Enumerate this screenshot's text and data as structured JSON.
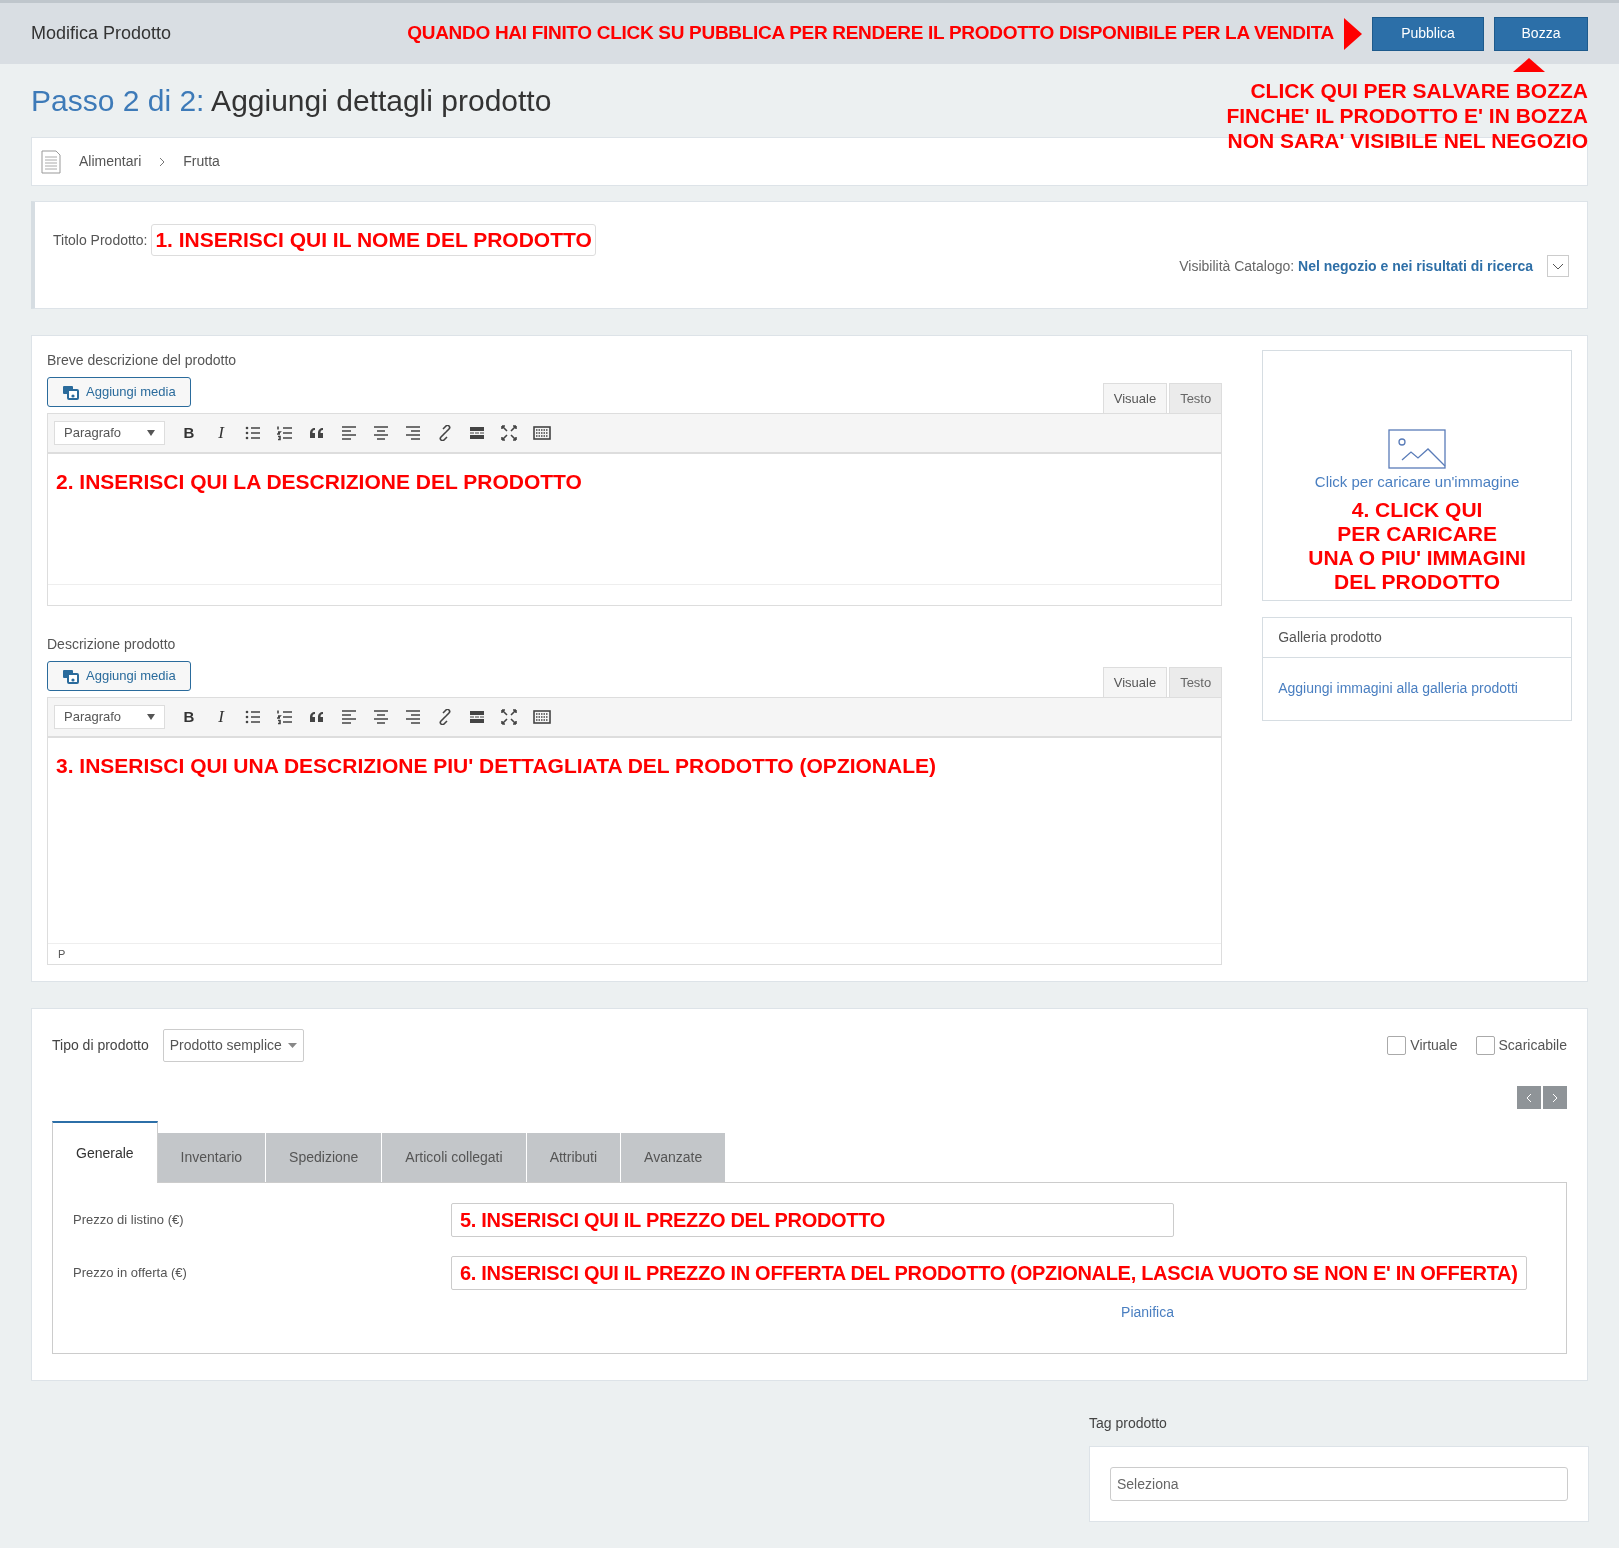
{
  "header": {
    "title": "Modifica Prodotto",
    "annotation": "QUANDO HAI FINITO CLICK SU PUBBLICA PER RENDERE IL PRODOTTO DISPONIBILE PER LA VENDITA",
    "buttons": [
      {
        "label": "Pubblica"
      },
      {
        "label": "Bozza"
      }
    ],
    "draft_annotation": [
      "CLICK QUI PER SALVARE BOZZA",
      "FINCHE' IL PRODOTTO E' IN BOZZA",
      "NON SARA' VISIBILE NEL NEGOZIO"
    ]
  },
  "page_heading": {
    "step": "Passo 2 di 2:",
    "title": "Aggiungi dettagli prodotto"
  },
  "breadcrumb": [
    "Alimentari",
    "Frutta"
  ],
  "title_box": {
    "label": "Titolo Prodotto:",
    "annotation": "1. INSERISCI QUI IL NOME DEL PRODOTTO",
    "visibility_label": "Visibilità Catalogo:",
    "visibility_value": "Nel negozio e nei risultati di ricerca"
  },
  "editors": [
    {
      "label": "Breve descrizione del prodotto",
      "media_button": "Aggiungi media",
      "tabs": [
        {
          "label": "Visuale",
          "selected": true
        },
        {
          "label": "Testo",
          "selected": false
        }
      ],
      "format": "Paragrafo",
      "annotation": "2. INSERISCI QUI LA DESCRIZIONE DEL PRODOTTO",
      "toolbar": [
        {
          "kind": "bold",
          "label": "B"
        },
        {
          "kind": "italic",
          "label": "I"
        },
        {
          "kind": "bullets"
        },
        {
          "kind": "numbers"
        },
        {
          "kind": "quote"
        },
        {
          "kind": "align-left"
        },
        {
          "kind": "align-center"
        },
        {
          "kind": "align-right"
        },
        {
          "kind": "link"
        },
        {
          "kind": "more"
        },
        {
          "kind": "fullscreen"
        },
        {
          "kind": "keyboard"
        }
      ]
    },
    {
      "label": "Descrizione prodotto",
      "media_button": "Aggiungi media",
      "tabs": [
        {
          "label": "Visuale",
          "selected": true
        },
        {
          "label": "Testo",
          "selected": false
        }
      ],
      "format": "Paragrafo",
      "annotation": "3. INSERISCI QUI UNA DESCRIZIONE PIU' DETTAGLIATA DEL PRODOTTO (OPZIONALE)",
      "path": "P",
      "toolbar": [
        {
          "kind": "bold",
          "label": "B"
        },
        {
          "kind": "italic",
          "label": "I"
        },
        {
          "kind": "bullets"
        },
        {
          "kind": "numbers"
        },
        {
          "kind": "quote"
        },
        {
          "kind": "align-left"
        },
        {
          "kind": "align-center"
        },
        {
          "kind": "align-right"
        },
        {
          "kind": "link"
        },
        {
          "kind": "more"
        },
        {
          "kind": "fullscreen"
        },
        {
          "kind": "keyboard"
        }
      ]
    }
  ],
  "image_box": {
    "upload_link": "Click per caricare un'immagine",
    "annotation": [
      "4. CLICK QUI",
      "PER CARICARE",
      "UNA O PIU' IMMAGINI",
      "DEL PRODOTTO"
    ]
  },
  "gallery": {
    "title": "Galleria prodotto",
    "link": "Aggiungi immagini alla galleria prodotti"
  },
  "product_data": {
    "type_label": "Tipo di prodotto",
    "type_value": "Prodotto semplice",
    "checkboxes": [
      {
        "label": "Virtuale",
        "checked": false
      },
      {
        "label": "Scaricabile",
        "checked": false
      }
    ],
    "tabs": [
      {
        "label": "Generale",
        "selected": true
      },
      {
        "label": "Inventario",
        "selected": false
      },
      {
        "label": "Spedizione",
        "selected": false
      },
      {
        "label": "Articoli collegati",
        "selected": false
      },
      {
        "label": "Attributi",
        "selected": false
      },
      {
        "label": "Avanzate",
        "selected": false
      }
    ],
    "fields": [
      {
        "label": "Prezzo di listino (€)",
        "annotation": "5. INSERISCI QUI IL PREZZO DEL PRODOTTO"
      },
      {
        "label": "Prezzo in offerta (€)",
        "annotation": "6. INSERISCI QUI IL PREZZO IN OFFERTA DEL PRODOTTO (OPZIONALE, LASCIA VUOTO SE NON E' IN OFFERTA)"
      }
    ],
    "schedule_link": "Pianifica"
  },
  "tags": {
    "title": "Tag prodotto",
    "placeholder": "Seleziona"
  }
}
